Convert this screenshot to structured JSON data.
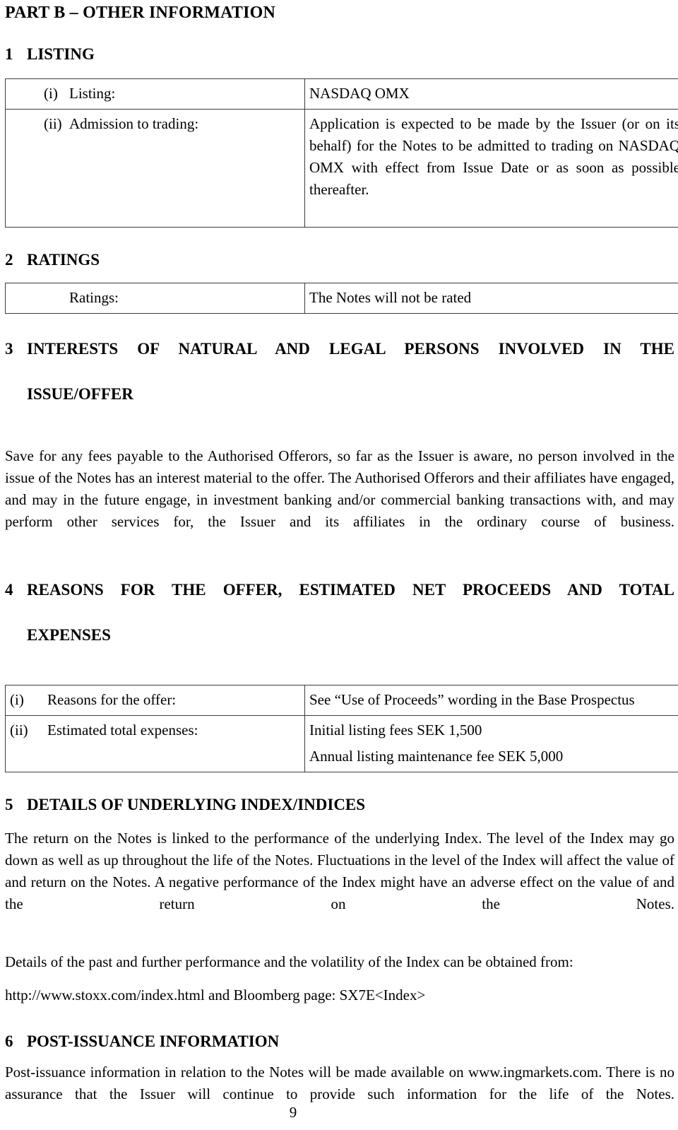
{
  "document": {
    "part_title": "PART B – OTHER INFORMATION",
    "page_number": "9"
  },
  "sections": [
    {
      "number": "1",
      "title": "LISTING",
      "table": {
        "rows": [
          {
            "roman": "(i)",
            "label": "Listing:",
            "value_lines": [
              "NASDAQ OMX"
            ]
          },
          {
            "roman": "(ii)",
            "label": "Admission to trading:",
            "value_lines": [
              "Application is expected to be made by the Issuer (or on its behalf) for the Notes to be admitted to trading on NASDAQ OMX with effect from Issue Date or as soon as possible thereafter."
            ]
          }
        ]
      }
    },
    {
      "number": "2",
      "title": "RATINGS",
      "table": {
        "rows": [
          {
            "roman": "",
            "label": "Ratings:",
            "value_lines": [
              "The Notes will not be rated"
            ]
          }
        ]
      }
    },
    {
      "number": "3",
      "title_line1": "INTERESTS OF NATURAL AND LEGAL PERSONS INVOLVED IN THE",
      "title_line2": "ISSUE/OFFER",
      "paragraphs": [
        "Save for any fees payable to the Authorised Offerors, so far as the Issuer is aware, no person involved in the issue of the Notes has an interest material to the offer. The Authorised Offerors and their affiliates have engaged, and may in the future engage, in investment banking and/or commercial banking transactions with, and may perform other services for, the Issuer and its affiliates in the ordinary course of business."
      ]
    },
    {
      "number": "4",
      "title_line1": "REASONS FOR THE OFFER, ESTIMATED NET PROCEEDS AND TOTAL",
      "title_line2": "EXPENSES",
      "table": {
        "rows": [
          {
            "roman": "(i)",
            "label": "Reasons for the offer:",
            "value_lines": [
              "See “Use of Proceeds” wording in the Base Prospectus"
            ]
          },
          {
            "roman": "(ii)",
            "label": "Estimated total expenses:",
            "value_lines": [
              "Initial listing fees SEK 1,500",
              "Annual listing maintenance fee SEK 5,000"
            ]
          }
        ]
      }
    },
    {
      "number": "5",
      "title": "DETAILS OF UNDERLYING INDEX/INDICES",
      "paragraphs": [
        "The return on the Notes is linked to the performance of the underlying Index. The level of the Index may go down as well as up throughout the life of the Notes. Fluctuations in the level of the Index will affect the value of and return on the Notes. A negative performance of the Index might have an adverse effect on the value of and the return on the Notes.",
        "Details of the past and further performance and the volatility of the Index can be obtained from:",
        "http://www.stoxx.com/index.html and Bloomberg page: SX7E<Index>"
      ]
    },
    {
      "number": "6",
      "title": "POST-ISSUANCE INFORMATION",
      "paragraphs": [
        "Post-issuance information in relation to the Notes will be made available on www.ingmarkets.com. There is no assurance that the Issuer will continue to provide such information for the life of the Notes."
      ]
    }
  ]
}
